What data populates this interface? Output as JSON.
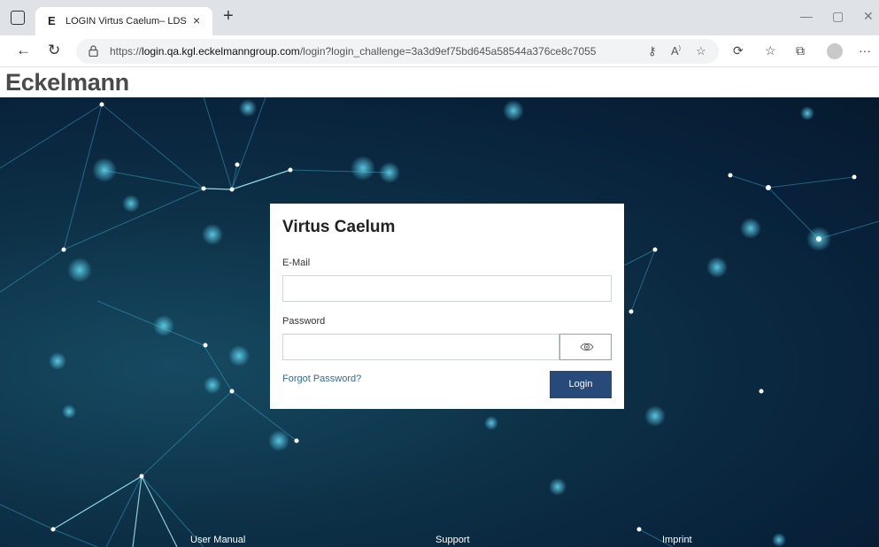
{
  "browser": {
    "tab_favicon": "E",
    "tab_title": "LOGIN Virtus Caelum– LDS",
    "tab_close": "×",
    "new_tab": "+",
    "url_prefix": "https://",
    "url_host": "login.qa.kgl.eckelmanngroup.com",
    "url_path": "/login?login_challenge=3a3d9ef75bd645a58544a376ce8c7055",
    "icons": [
      "back-icon",
      "refresh-icon",
      "lock-icon",
      "key-icon",
      "read-aloud-icon",
      "favorite-icon",
      "extensions-icon",
      "favorites-icon",
      "collections-icon",
      "profile-icon",
      "more-icon"
    ]
  },
  "header": {
    "logo_text": "Eckelmann"
  },
  "login": {
    "title": "Virtus Caelum",
    "email_label": "E-Mail",
    "email_value": "",
    "password_label": "Password",
    "password_value": "",
    "forgot_link": "Forgot Password?",
    "login_button": "Login"
  },
  "footer": {
    "user_manual": "User Manual",
    "support": "Support",
    "imprint": "Imprint"
  },
  "colors": {
    "primary_button": "#274a7a",
    "link": "#2f6aa8",
    "background_dark": "#08213a",
    "network_accent": "#46c8e6"
  }
}
